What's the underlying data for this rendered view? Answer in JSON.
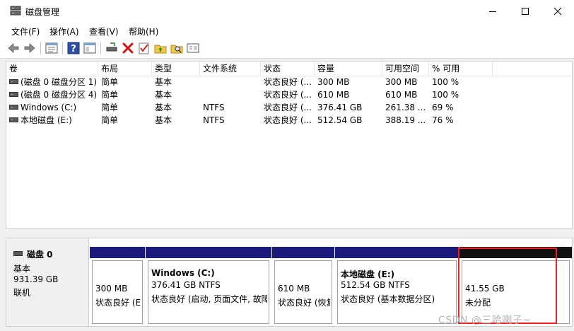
{
  "window": {
    "title": "磁盘管理"
  },
  "menu": [
    {
      "label": "文件(F)"
    },
    {
      "label": "操作(A)"
    },
    {
      "label": "查看(V)"
    },
    {
      "label": "帮助(H)"
    }
  ],
  "toolbar": {
    "icons": [
      "back-arrow-icon",
      "forward-arrow-icon",
      "properties-list-icon",
      "help-icon",
      "view-panel-icon",
      "connect-icon",
      "delete-icon",
      "check-icon",
      "folder-up-icon",
      "search-folder-icon",
      "settings-window-icon"
    ]
  },
  "volume_table": {
    "columns": [
      "卷",
      "布局",
      "类型",
      "文件系统",
      "状态",
      "容量",
      "可用空间",
      "% 可用"
    ],
    "rows": [
      [
        "(磁盘 0 磁盘分区 1)",
        "简单",
        "基本",
        "",
        "状态良好 (...",
        "300 MB",
        "300 MB",
        "100 %"
      ],
      [
        "(磁盘 0 磁盘分区 4)",
        "简单",
        "基本",
        "",
        "状态良好 (...",
        "610 MB",
        "610 MB",
        "100 %"
      ],
      [
        "Windows (C:)",
        "简单",
        "基本",
        "NTFS",
        "状态良好 (...",
        "376.41 GB",
        "261.38 ...",
        "69 %"
      ],
      [
        "本地磁盘 (E:)",
        "简单",
        "基本",
        "NTFS",
        "状态良好 (...",
        "512.54 GB",
        "388.19 ...",
        "76 %"
      ]
    ]
  },
  "disk": {
    "name": "磁盘 0",
    "type": "基本",
    "size": "931.39 GB",
    "status": "联机",
    "partitions": [
      {
        "title": "",
        "size": "300 MB",
        "status": "状态良好 (E"
      },
      {
        "title": "Windows  (C:)",
        "size": "376.41 GB NTFS",
        "status": "状态良好 (启动, 页面文件, 故障"
      },
      {
        "title": "",
        "size": "610 MB",
        "status": "状态良好 (恢复"
      },
      {
        "title": "本地磁盘  (E:)",
        "size": "512.54 GB NTFS",
        "status": "状态良好 (基本数据分区)"
      },
      {
        "title": "",
        "size": "41.55 GB",
        "status": "未分配"
      }
    ]
  },
  "watermark": "CSDN @三哈喇子~",
  "colors": {
    "primary_partition_bar": "#1a1a7a",
    "unallocated_bar": "#111111",
    "annotation": "#e22222"
  }
}
